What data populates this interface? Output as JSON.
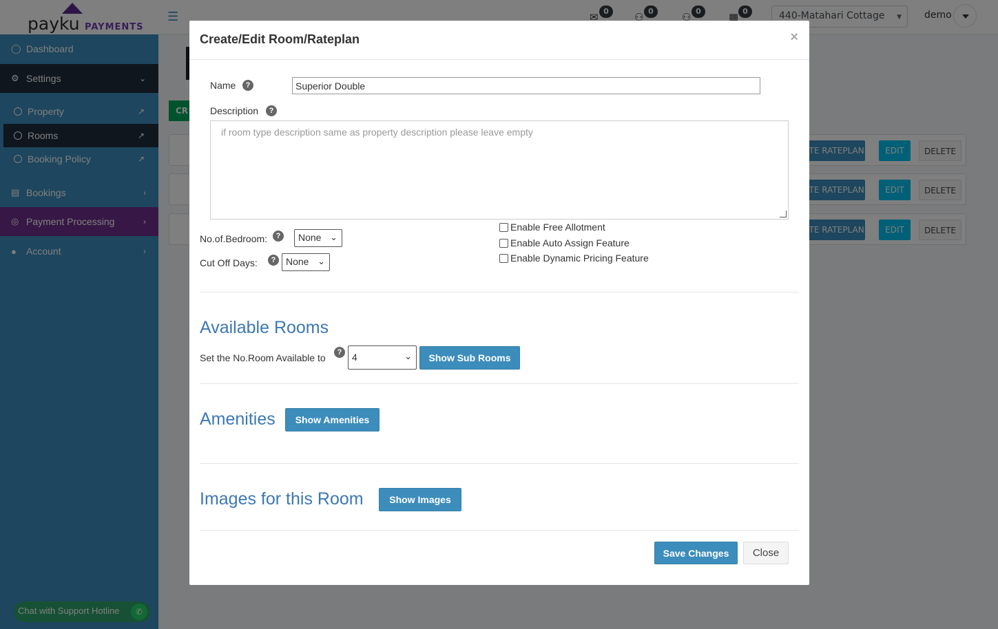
{
  "topbar": {
    "brand": "payku",
    "brand_sub": "PAYMENTS",
    "notifications": [
      {
        "icon": "envelope-icon",
        "count": "0"
      },
      {
        "icon": "users-icon",
        "count": "0"
      },
      {
        "icon": "users-alt-icon",
        "count": "0"
      },
      {
        "icon": "calendar-icon",
        "count": "0"
      }
    ],
    "property_selected": "440-Matahari Cottage",
    "user": "demo"
  },
  "sidebar": {
    "dashboard": "Dashboard",
    "settings": "Settings",
    "sub_items": [
      "Property",
      "Rooms",
      "Booking Policy"
    ],
    "bookings": "Bookings",
    "payment_processing": "Payment Processing",
    "account": "Account",
    "chat": "Chat with Support Hotline"
  },
  "background": {
    "create_label": "CR",
    "rows": [
      {
        "create_rateplan": "ATE RATEPLAN",
        "edit": "EDIT",
        "delete": "DELETE"
      },
      {
        "create_rateplan": "ATE RATEPLAN",
        "edit": "EDIT",
        "delete": "DELETE"
      },
      {
        "create_rateplan": "ATE RATEPLAN",
        "edit": "EDIT",
        "delete": "DELETE"
      }
    ]
  },
  "modal": {
    "title": "Create/Edit Room/Rateplan",
    "close_symbol": "×",
    "name_label": "Name",
    "name_value": "Superior Double",
    "description_label": "Description",
    "description_placeholder": "if room type description same as property description please leave empty",
    "bedroom_label": "No.of.Bedroom:",
    "bedroom_value": "None",
    "cutoff_label": "Cut Off Days:",
    "cutoff_value": "None",
    "checkboxes": [
      "Enable Free Allotment",
      "Enable Auto Assign Feature",
      "Enable Dynamic Pricing Feature"
    ],
    "available_rooms_title": "Available Rooms",
    "available_label": "Set the No.Room Available to",
    "available_value": "4",
    "show_sub_rooms": "Show Sub Rooms",
    "amenities_title": "Amenities",
    "show_amenities": "Show Amenities",
    "images_title": "Images for this Room",
    "show_images": "Show Images",
    "save": "Save Changes",
    "close": "Close"
  }
}
